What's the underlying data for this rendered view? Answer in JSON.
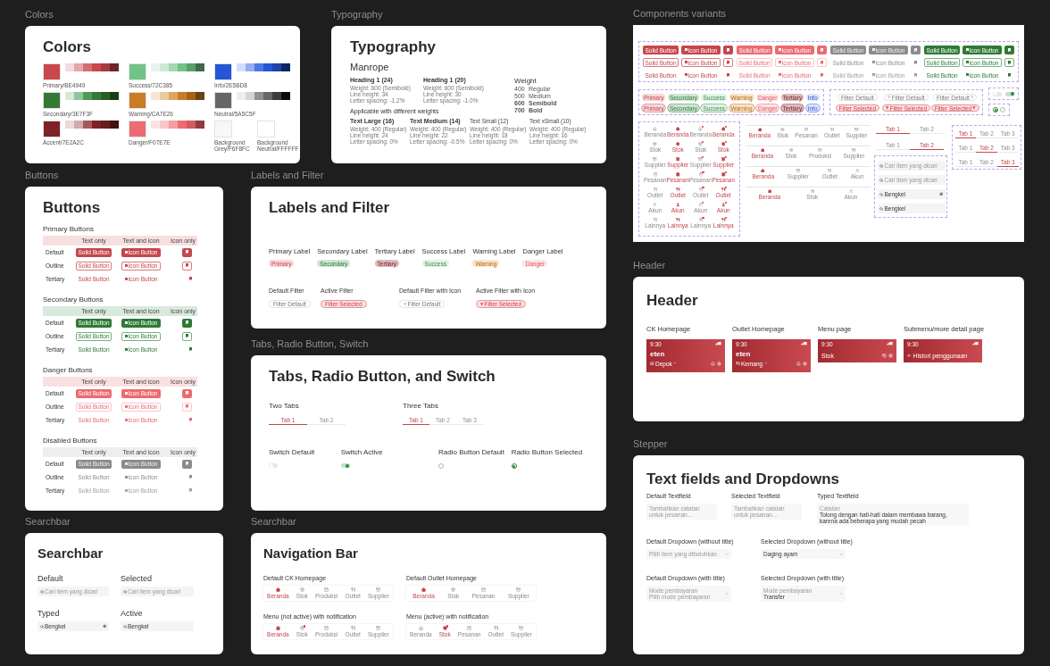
{
  "colors": {
    "frame_label": "Colors",
    "title": "Colors",
    "swatches": [
      {
        "name": "Primary/BE4949",
        "color": "#c9474d",
        "shades": [
          {
            "color": "#f2dcdd"
          },
          {
            "color": "#e4a7aa"
          },
          {
            "color": "#d56e72"
          },
          {
            "color": "#c9474d"
          },
          {
            "color": "#a53a3f"
          },
          {
            "color": "#6d2629"
          }
        ]
      },
      {
        "name": "Success/72C385",
        "color": "#72c386",
        "shades": [
          {
            "color": "#e8f5eb"
          },
          {
            "color": "#cbe9d2"
          },
          {
            "color": "#a3d8b0"
          },
          {
            "color": "#72c386"
          },
          {
            "color": "#5aa06c"
          },
          {
            "color": "#3b6b47"
          }
        ]
      },
      {
        "name": "Info/2E5BD8",
        "color": "#2456d6",
        "shades": [
          {
            "color": "#d3def9"
          },
          {
            "color": "#94adef"
          },
          {
            "color": "#4d78e2"
          },
          {
            "color": "#2456d6"
          },
          {
            "color": "#1c44aa"
          },
          {
            "color": "#0f2563"
          }
        ]
      },
      {
        "name": "Secondary/3E7F3F",
        "color": "#367936",
        "shades": [
          {
            "color": "#d9e9d9"
          },
          {
            "color": "#94c39e"
          },
          {
            "color": "#4f9a5c"
          },
          {
            "color": "#367936"
          },
          {
            "color": "#2a5e2a"
          },
          {
            "color": "#1a3b1a"
          }
        ]
      },
      {
        "name": "Warning/CA7E26",
        "color": "#c87c24",
        "shades": [
          {
            "color": "#f6e7d3"
          },
          {
            "color": "#eacb9f"
          },
          {
            "color": "#dda462"
          },
          {
            "color": "#c87c24"
          },
          {
            "color": "#a2641d"
          },
          {
            "color": "#6b4213"
          }
        ]
      },
      {
        "name": "Neutral/5A5C5F",
        "color": "#666666",
        "shades": [
          {
            "color": "#eeeeee"
          },
          {
            "color": "#d6d6d6"
          },
          {
            "color": "#919191"
          },
          {
            "color": "#666666"
          },
          {
            "color": "#3b3b3b"
          },
          {
            "color": "#0b0b0b"
          }
        ]
      },
      {
        "name": "Accent/7E2A2C",
        "color": "#7e2226",
        "shades": [
          {
            "color": "#ead9da"
          },
          {
            "color": "#d0abad"
          },
          {
            "color": "#a6595d"
          },
          {
            "color": "#7e2226"
          },
          {
            "color": "#671c1f"
          },
          {
            "color": "#411214"
          }
        ]
      },
      {
        "name": "Danger/F07E7E",
        "color": "#ec6c72",
        "shades": [
          {
            "color": "#fce2e3"
          },
          {
            "color": "#f7c6c8"
          },
          {
            "color": "#f29ea2"
          },
          {
            "color": "#ec6c72"
          },
          {
            "color": "#d45a60"
          },
          {
            "color": "#8e3b3f"
          }
        ]
      },
      {
        "name": "Background Grey/F6F8FC",
        "color": "#f6f8fa"
      },
      {
        "name": "Background Neutral/FFFFFF",
        "color": "#ffffff"
      }
    ]
  },
  "typography": {
    "frame_label": "Typography",
    "title": "Typography",
    "font_name": "Manrope",
    "headings": [
      {
        "title": "Heading 1 (24)",
        "specs": [
          "Weight: 600 (Semibold)",
          "Line height: 34",
          "Letter spacing: -1.2%"
        ]
      },
      {
        "title": "Heading 1 (20)",
        "specs": [
          "Weight: 600 (Semibold)",
          "Line height: 30",
          "Letter spacing: -1.0%"
        ]
      }
    ],
    "weights_title": "Weight",
    "weights": [
      {
        "value": "400",
        "name": "Regular"
      },
      {
        "value": "500",
        "name": "Medium"
      },
      {
        "value": "600",
        "name": "Semibold"
      },
      {
        "value": "700",
        "name": "Bold"
      }
    ],
    "subtitle": "Applicable with different weights",
    "text_styles": [
      {
        "title": "Text Large (16)",
        "specs": [
          "Weight: 400 (Regular)",
          "Line height: 24",
          "Letter spacing: 0%"
        ]
      },
      {
        "title": "Text Medium (14)",
        "specs": [
          "Weight: 400 (Regular)",
          "Line height: 22",
          "Letter spacing: -0.5%"
        ]
      },
      {
        "title": "Text Small (12)",
        "specs": [
          "Weight: 400 (Regular)",
          "Line height: 18",
          "Letter spacing: 0%"
        ]
      },
      {
        "title": "Text xSmall (10)",
        "specs": [
          "Weight: 400 (Regular)",
          "Line height: 16",
          "Letter spacing: 0%"
        ]
      }
    ]
  },
  "components_variants": {
    "frame_label": "Components variants",
    "button_sets": [
      {
        "kind": "primary",
        "rows": [
          {
            "kind": "solid",
            "text": "Solid Button",
            "icon_text": "Icon Button"
          },
          {
            "kind": "outline",
            "text": "Solid Button",
            "icon_text": "Icon Button"
          },
          {
            "kind": "tertiary",
            "text": "Solid Button",
            "icon_text": "Icon Button"
          }
        ]
      },
      {
        "kind": "danger",
        "rows": [
          {
            "kind": "solid",
            "text": "Solid Button",
            "icon_text": "Icon Button"
          },
          {
            "kind": "outline",
            "text": "Solid Button",
            "icon_text": "Icon Button"
          },
          {
            "kind": "tertiary",
            "text": "Solid Button",
            "icon_text": "Icon Button"
          }
        ]
      },
      {
        "kind": "disabled",
        "rows": [
          {
            "kind": "solid",
            "text": "Solid Button",
            "icon_text": "Icon Button"
          },
          {
            "kind": "outline",
            "text": "Solid Button",
            "icon_text": "Icon Button"
          },
          {
            "kind": "tertiary",
            "text": "Solid Button",
            "icon_text": "Icon Button"
          }
        ]
      },
      {
        "kind": "secondary",
        "rows": [
          {
            "kind": "solid",
            "text": "Solid Button",
            "icon_text": "Icon Button"
          },
          {
            "kind": "outline",
            "text": "Solid Button",
            "icon_text": "Icon Button"
          },
          {
            "kind": "tertiary",
            "text": "Solid Button",
            "icon_text": "Icon Button"
          }
        ]
      }
    ],
    "label_rows": [
      {
        "kind": "filled",
        "labels": [
          {
            "text": "Primary",
            "kind": "primary"
          },
          {
            "text": "Secondary",
            "kind": "secondary"
          },
          {
            "text": "Success",
            "kind": "success"
          },
          {
            "text": "Warning",
            "kind": "warning"
          },
          {
            "text": "Danger",
            "kind": "danger"
          },
          {
            "text": "Tertiary",
            "kind": "tertiary"
          },
          {
            "text": "Info",
            "kind": "info"
          }
        ]
      },
      {
        "kind": "outlined",
        "labels": [
          {
            "text": "Primary",
            "kind": "primary"
          },
          {
            "text": "Secondary",
            "kind": "secondary"
          },
          {
            "text": "Success",
            "kind": "success"
          },
          {
            "text": "Warning",
            "kind": "warning"
          },
          {
            "text": "Danger",
            "kind": "danger"
          },
          {
            "text": "Tertiary",
            "kind": "tertiary"
          },
          {
            "text": "Info",
            "kind": "info"
          }
        ]
      }
    ],
    "filter_rows": [
      {
        "items": [
          {
            "text": "Filter Default",
            "selected": false,
            "kind": "plain"
          },
          {
            "text": "Filter Default",
            "selected": false,
            "kind": "icon_start"
          },
          {
            "text": "Filter Default",
            "selected": false,
            "kind": "icon_end"
          }
        ]
      },
      {
        "items": [
          {
            "text": "Filter Selected",
            "selected": true,
            "kind": "plain"
          },
          {
            "text": "Filter Selected",
            "selected": true,
            "kind": "icon_start"
          },
          {
            "text": "Filter Selected",
            "selected": true,
            "kind": "icon_end"
          }
        ]
      }
    ],
    "switches": [
      {
        "on": false
      },
      {
        "on": true
      }
    ],
    "radios": [
      {
        "checked": true
      },
      {
        "checked": false
      }
    ],
    "nav_icon_rows": [
      {
        "items": [
          {
            "label": "Beranda",
            "kind": "home",
            "active": false,
            "notification": false
          },
          {
            "label": "Beranda",
            "kind": "home",
            "active": true,
            "notification": false
          },
          {
            "label": "Beranda",
            "kind": "home",
            "active": false,
            "notification": true
          },
          {
            "label": "Beranda",
            "kind": "home",
            "active": true,
            "notification": true
          }
        ]
      },
      {
        "items": [
          {
            "label": "Stok",
            "kind": "stock",
            "active": false,
            "notification": false
          },
          {
            "label": "Stok",
            "kind": "stock",
            "active": true,
            "notification": false
          },
          {
            "label": "Stok",
            "kind": "stock",
            "active": false,
            "notification": true
          },
          {
            "label": "Stok",
            "kind": "stock",
            "active": true,
            "notification": true
          }
        ]
      },
      {
        "items": [
          {
            "label": "Supplier",
            "kind": "supplier",
            "active": false,
            "notification": false
          },
          {
            "label": "Supplier",
            "kind": "supplier",
            "active": true,
            "notification": false
          },
          {
            "label": "Supplier",
            "kind": "supplier",
            "active": false,
            "notification": true
          },
          {
            "label": "Supplier",
            "kind": "supplier",
            "active": true,
            "notification": true
          }
        ]
      },
      {
        "items": [
          {
            "label": "Pesanan",
            "kind": "production",
            "active": false,
            "notification": false
          },
          {
            "label": "Pesanan",
            "kind": "production",
            "active": true,
            "notification": false
          },
          {
            "label": "Pesanan",
            "kind": "production",
            "active": false,
            "notification": true
          },
          {
            "label": "Pesanan",
            "kind": "production",
            "active": true,
            "notification": true
          }
        ]
      },
      {
        "items": [
          {
            "label": "Outlet",
            "kind": "outlet",
            "active": false,
            "notification": false
          },
          {
            "label": "Outlet",
            "kind": "outlet",
            "active": true,
            "notification": false
          },
          {
            "label": "Outlet",
            "kind": "outlet",
            "active": false,
            "notification": true
          },
          {
            "label": "Outlet",
            "kind": "outlet",
            "active": true,
            "notification": true
          }
        ]
      },
      {
        "items": [
          {
            "label": "Akun",
            "kind": "account",
            "active": false,
            "notification": false
          },
          {
            "label": "Akun",
            "kind": "account",
            "active": true,
            "notification": false
          },
          {
            "label": "Akun",
            "kind": "account",
            "active": false,
            "notification": true
          },
          {
            "label": "Akun",
            "kind": "account",
            "active": true,
            "notification": true
          }
        ]
      },
      {
        "items": [
          {
            "label": "Lainnya",
            "kind": "outlet",
            "active": false,
            "notification": false
          },
          {
            "label": "Lainnya",
            "kind": "outlet",
            "active": true,
            "notification": false
          },
          {
            "label": "Lainnya",
            "kind": "outlet",
            "active": false,
            "notification": true
          },
          {
            "label": "Lainnya",
            "kind": "outlet",
            "active": true,
            "notification": true
          }
        ]
      }
    ],
    "nav_bars": [
      {
        "items": [
          {
            "label": "Beranda",
            "kind": "home",
            "active": true,
            "notification": false
          },
          {
            "label": "Stok",
            "kind": "stock",
            "active": false,
            "notification": false
          },
          {
            "label": "Pesanan",
            "kind": "production",
            "active": false,
            "notification": false
          },
          {
            "label": "Outlet",
            "kind": "outlet",
            "active": false,
            "notification": false
          },
          {
            "label": "Supplier",
            "kind": "supplier",
            "active": false,
            "notification": false
          }
        ]
      },
      {
        "items": [
          {
            "label": "Beranda",
            "kind": "home",
            "active": true,
            "notification": false
          },
          {
            "label": "Stok",
            "kind": "stock",
            "active": false,
            "notification": false
          },
          {
            "label": "Produksi",
            "kind": "production",
            "active": false,
            "notification": false
          },
          {
            "label": "Supplier",
            "kind": "supplier",
            "active": false,
            "notification": false
          }
        ]
      },
      {
        "items": [
          {
            "label": "Beranda",
            "kind": "home",
            "active": true,
            "notification": false
          },
          {
            "label": "Supplier",
            "kind": "supplier",
            "active": false,
            "notification": false
          },
          {
            "label": "Outlet",
            "kind": "outlet",
            "active": false,
            "notification": false
          },
          {
            "label": "Akun",
            "kind": "account",
            "active": false,
            "notification": false
          }
        ]
      },
      {
        "items": [
          {
            "label": "Beranda",
            "kind": "home",
            "active": true,
            "notification": false
          },
          {
            "label": "Stok",
            "kind": "stock",
            "active": false,
            "notification": false
          },
          {
            "label": "Akun",
            "kind": "account",
            "active": false,
            "notification": false
          }
        ]
      }
    ],
    "two_tab_rows": [
      {
        "tabs": [
          {
            "label": "Tab 1",
            "selected": true
          },
          {
            "label": "Tab 2",
            "selected": false
          }
        ]
      },
      {
        "tabs": [
          {
            "label": "Tab 1",
            "selected": false
          },
          {
            "label": "Tab 2",
            "selected": true
          }
        ]
      }
    ],
    "search_fields": [
      {
        "placeholder": "Cari item yang dicari",
        "clear_button": false
      },
      {
        "placeholder": "Cari item yang dicari",
        "clear_button": false
      },
      {
        "value": "Bengkel",
        "clear_button": true
      },
      {
        "value": "Bengkel",
        "clear_button": false
      }
    ],
    "three_tab_rows": [
      {
        "tabs": [
          {
            "label": "Tab 1",
            "selected": true
          },
          {
            "label": "Tab 2",
            "selected": false
          },
          {
            "label": "Tab 3",
            "selected": false
          }
        ]
      },
      {
        "tabs": [
          {
            "label": "Tab 1",
            "selected": false
          },
          {
            "label": "Tab 2",
            "selected": true
          },
          {
            "label": "Tab 3",
            "selected": false
          }
        ]
      },
      {
        "tabs": [
          {
            "label": "Tab 1",
            "selected": false
          },
          {
            "label": "Tab 2",
            "selected": false
          },
          {
            "label": "Tab 3",
            "selected": true
          }
        ]
      }
    ]
  },
  "buttons": {
    "frame_label": "Buttons",
    "title": "Buttons",
    "groups": [
      {
        "title": "Primary Buttons",
        "kind": "primary",
        "columns": [
          "Text only",
          "Text and icon",
          "Icon only"
        ],
        "rows": [
          {
            "label": "Default",
            "kind": "solid",
            "text": "Solid Button",
            "icon_text": "Icon Button"
          },
          {
            "label": "Outline",
            "kind": "outline",
            "text": "Solid Button",
            "icon_text": "Icon Button"
          },
          {
            "label": "Tertiary",
            "kind": "tertiary",
            "text": "Solid Button",
            "icon_text": "Icon Button"
          }
        ]
      },
      {
        "title": "Secondary Buttons",
        "kind": "secondary",
        "columns": [
          "Text only",
          "Text and icon",
          "Icon only"
        ],
        "rows": [
          {
            "label": "Default",
            "kind": "solid",
            "text": "Solid Button",
            "icon_text": "Icon Button"
          },
          {
            "label": "Outline",
            "kind": "outline",
            "text": "Solid Button",
            "icon_text": "Icon Button"
          },
          {
            "label": "Tertiary",
            "kind": "tertiary",
            "text": "Solid Button",
            "icon_text": "Icon Button"
          }
        ]
      },
      {
        "title": "Danger Buttons",
        "kind": "danger",
        "columns": [
          "Text only",
          "Text and icon",
          "Icon only"
        ],
        "rows": [
          {
            "label": "Default",
            "kind": "solid",
            "text": "Solid Button",
            "icon_text": "Icon Button"
          },
          {
            "label": "Outline",
            "kind": "outline",
            "text": "Solid Button",
            "icon_text": "Icon Button"
          },
          {
            "label": "Tertiary",
            "kind": "tertiary",
            "text": "Solid Button",
            "icon_text": "Icon Button"
          }
        ]
      },
      {
        "title": "Disabled Buttons",
        "kind": "disabled",
        "columns": [
          "Text only",
          "Text and icon",
          "Icon only"
        ],
        "rows": [
          {
            "label": "Default",
            "kind": "solid",
            "text": "Solid Button",
            "icon_text": "Icon Button"
          },
          {
            "label": "Outline",
            "kind": "outline",
            "text": "Solid Button",
            "icon_text": "Icon Button"
          },
          {
            "label": "Tertiary",
            "kind": "tertiary",
            "text": "Solid Button",
            "icon_text": "Icon Button"
          }
        ]
      }
    ]
  },
  "labels_and_filter": {
    "frame_label": "Labels and Filter",
    "title": "Labels and Filter",
    "labels": [
      {
        "title": "Primary Label",
        "text": "Primary",
        "kind": "primary"
      },
      {
        "title": "Secondary Label",
        "text": "Secondary",
        "kind": "secondary"
      },
      {
        "title": "Tertiary Label",
        "text": "Tertiary",
        "kind": "tertiary"
      },
      {
        "title": "Success Label",
        "text": "Success",
        "kind": "success"
      },
      {
        "title": "Warning Label",
        "text": "Warning",
        "kind": "warning"
      },
      {
        "title": "Danger Label",
        "text": "Danger",
        "kind": "danger"
      }
    ],
    "filters": [
      {
        "title": "Default Filter",
        "text": "Filter Default",
        "selected": false,
        "kind": "plain"
      },
      {
        "title": "Active Filter",
        "text": "Filter Selected",
        "selected": true,
        "kind": "plain"
      },
      {
        "title": "Default Filter with Icon",
        "text": "Filter Default",
        "selected": false,
        "kind": "icon_start"
      },
      {
        "title": "Active Filter with Icon",
        "text": "Filter Selected",
        "selected": true,
        "kind": "icon_start"
      }
    ]
  },
  "header": {
    "frame_label": "Header",
    "title": "Header",
    "headers": [
      {
        "title": "CK Homepage",
        "kind": "ck_home",
        "time": "9:30",
        "brand": "eten",
        "location": "Depok"
      },
      {
        "title": "Outlet Homepage",
        "kind": "outlet_home",
        "time": "9:30",
        "brand": "eten",
        "location": "Kemang"
      },
      {
        "title": "Menu page",
        "kind": "menu",
        "time": "9:30",
        "page_title": "Stok"
      },
      {
        "title": "Submenu/more detail page",
        "kind": "submenu",
        "time": "9:30",
        "page_title": "Histori penggunaan"
      }
    ]
  },
  "tabs_radio_switch": {
    "frame_label": "Tabs, Radio Button, Switch",
    "title": "Tabs, Radio Button, and Switch",
    "tab_groups": [
      {
        "title": "Two Tabs",
        "tabs": [
          {
            "label": "Tab 1",
            "selected": true
          },
          {
            "label": "Tab 2",
            "selected": false
          }
        ]
      },
      {
        "title": "Three Tabs",
        "tabs": [
          {
            "label": "Tab 1",
            "selected": true
          },
          {
            "label": "Tab 2",
            "selected": false
          },
          {
            "label": "Tab 3",
            "selected": false
          }
        ]
      }
    ],
    "controls": [
      {
        "title": "Switch Default",
        "kind": "switch",
        "on": false
      },
      {
        "title": "Switch Active",
        "kind": "switch",
        "on": true
      },
      {
        "title": "Radio Button Default",
        "kind": "radio",
        "checked": false
      },
      {
        "title": "Radio Button Selected",
        "kind": "radio",
        "checked": true
      }
    ]
  },
  "text_fields": {
    "frame_label": "Stepper",
    "title": "Text fields and Dropdowns",
    "textfields": [
      {
        "title": "Default Textfield",
        "placeholder": "Tambahkan catatan untuk pesanan..."
      },
      {
        "title": "Selected Textfield",
        "placeholder": "Tambahkan catatan untuk pesanan..."
      },
      {
        "title": "Typed Textfield",
        "field_label": "Catatan",
        "value": "Tolong dengan hati-hati dalam membawa barang, karena ada beberapa yang mudah pecah"
      }
    ],
    "dropdowns": [
      {
        "title": "Default Dropdown (without title)",
        "placeholder": "Pilih item yang dibutuhkan"
      },
      {
        "title": "Selected Dropdown (without title)",
        "value": "Daging ayam"
      },
      {
        "title": "Default Dropdown (with title)",
        "field_label": "Mode pembayaran",
        "placeholder": "Pilih mode pembayaran"
      },
      {
        "title": "Selected Dropdown (with title)",
        "field_label": "Mode pembayaran",
        "value": "Transfer"
      }
    ]
  },
  "searchbar": {
    "frame_label": "Searchbar",
    "title": "Searchbar",
    "fields": [
      {
        "title": "Default",
        "placeholder": "Cari item yang dicari",
        "clear_button": false
      },
      {
        "title": "Selected",
        "placeholder": "Cari item yang dicari",
        "clear_button": false
      },
      {
        "title": "Typed",
        "value": "Bengkel",
        "clear_button": true
      },
      {
        "title": "Active",
        "value": "Bengkel",
        "clear_button": false
      }
    ]
  },
  "navigation": {
    "frame_label": "Searchbar",
    "title": "Navigation Bar",
    "bars": [
      {
        "title": "Default CK Homepage",
        "items": [
          {
            "label": "Beranda",
            "kind": "home",
            "active": true,
            "notification": false
          },
          {
            "label": "Stok",
            "kind": "stock",
            "active": false,
            "notification": false
          },
          {
            "label": "Produksi",
            "kind": "production",
            "active": false,
            "notification": false
          },
          {
            "label": "Outlet",
            "kind": "outlet",
            "active": false,
            "notification": false
          },
          {
            "label": "Supplier",
            "kind": "supplier",
            "active": false,
            "notification": false
          }
        ]
      },
      {
        "title": "Default Outlet Homepage",
        "items": [
          {
            "label": "Beranda",
            "kind": "home",
            "active": true,
            "notification": false
          },
          {
            "label": "Stok",
            "kind": "stock",
            "active": false,
            "notification": false
          },
          {
            "label": "Pesanan",
            "kind": "production",
            "active": false,
            "notification": false
          },
          {
            "label": "Supplier",
            "kind": "supplier",
            "active": false,
            "notification": false
          }
        ]
      },
      {
        "title": "Menu (not active) with notification",
        "items": [
          {
            "label": "Beranda",
            "kind": "home",
            "active": true,
            "notification": false
          },
          {
            "label": "Stok",
            "kind": "stock",
            "active": false,
            "notification": true
          },
          {
            "label": "Produksi",
            "kind": "production",
            "active": false,
            "notification": false
          },
          {
            "label": "Outlet",
            "kind": "outlet",
            "active": false,
            "notification": false
          },
          {
            "label": "Supplier",
            "kind": "supplier",
            "active": false,
            "notification": false
          }
        ]
      },
      {
        "title": "Menu (active) with notification",
        "items": [
          {
            "label": "Beranda",
            "kind": "home",
            "active": false,
            "notification": false
          },
          {
            "label": "Stok",
            "kind": "stock",
            "active": true,
            "notification": true
          },
          {
            "label": "Pesanan",
            "kind": "production",
            "active": false,
            "notification": false
          },
          {
            "label": "Outlet",
            "kind": "outlet",
            "active": false,
            "notification": false
          },
          {
            "label": "Supplier",
            "kind": "supplier",
            "active": false,
            "notification": false
          }
        ]
      }
    ]
  }
}
